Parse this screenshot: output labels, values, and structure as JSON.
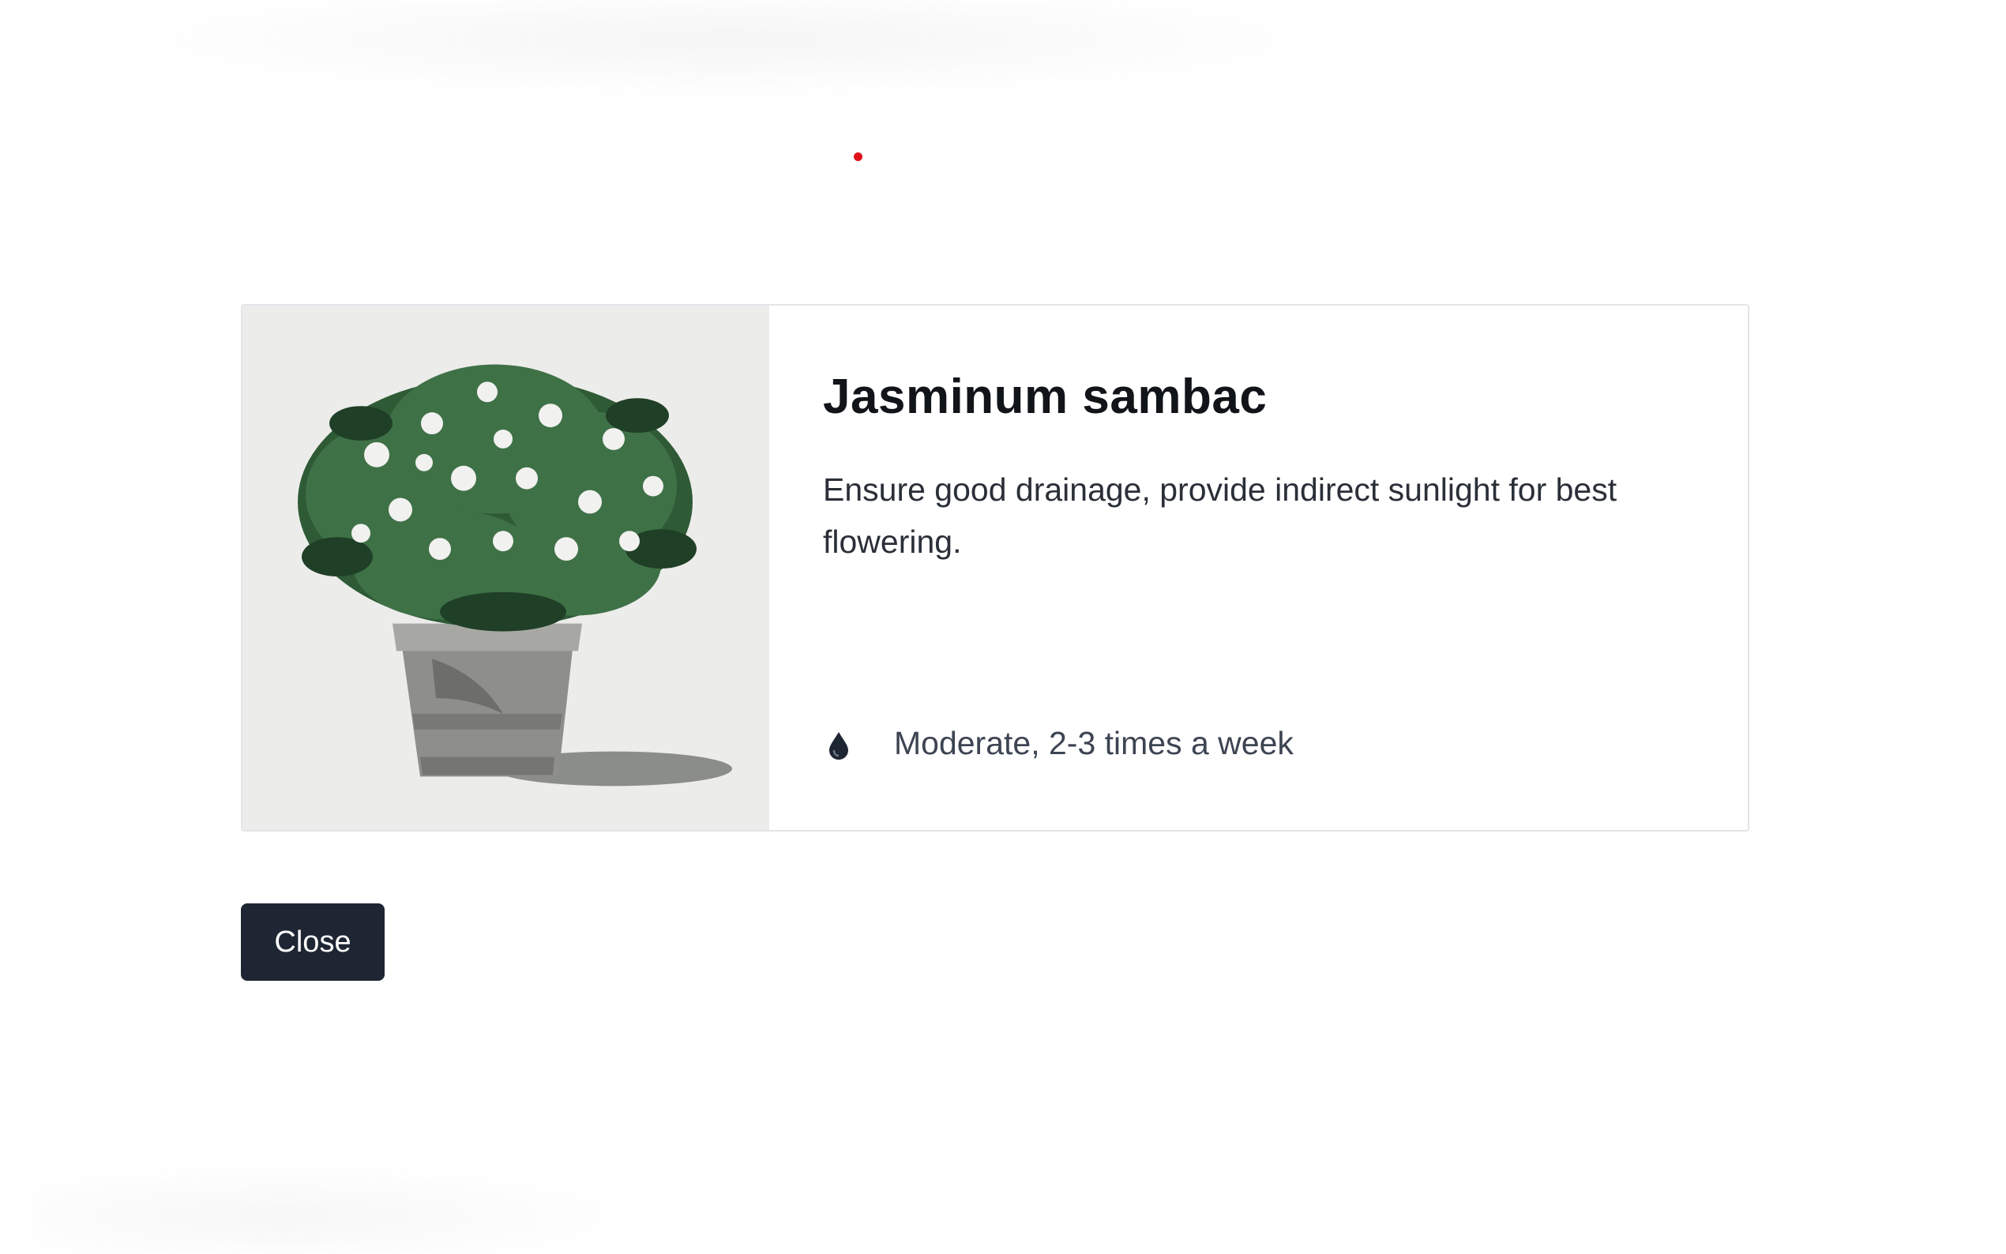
{
  "plant": {
    "name": "Jasminum sambac",
    "description": "Ensure good drainage, provide indirect sunlight for best flowering.",
    "watering_icon": "water-drop-icon",
    "watering": "Moderate, 2-3 times a week"
  },
  "actions": {
    "close_label": "Close"
  },
  "colors": {
    "button_bg": "#1f2633",
    "indicator_dot": "#e0111a",
    "card_border": "#e3e5e8"
  }
}
